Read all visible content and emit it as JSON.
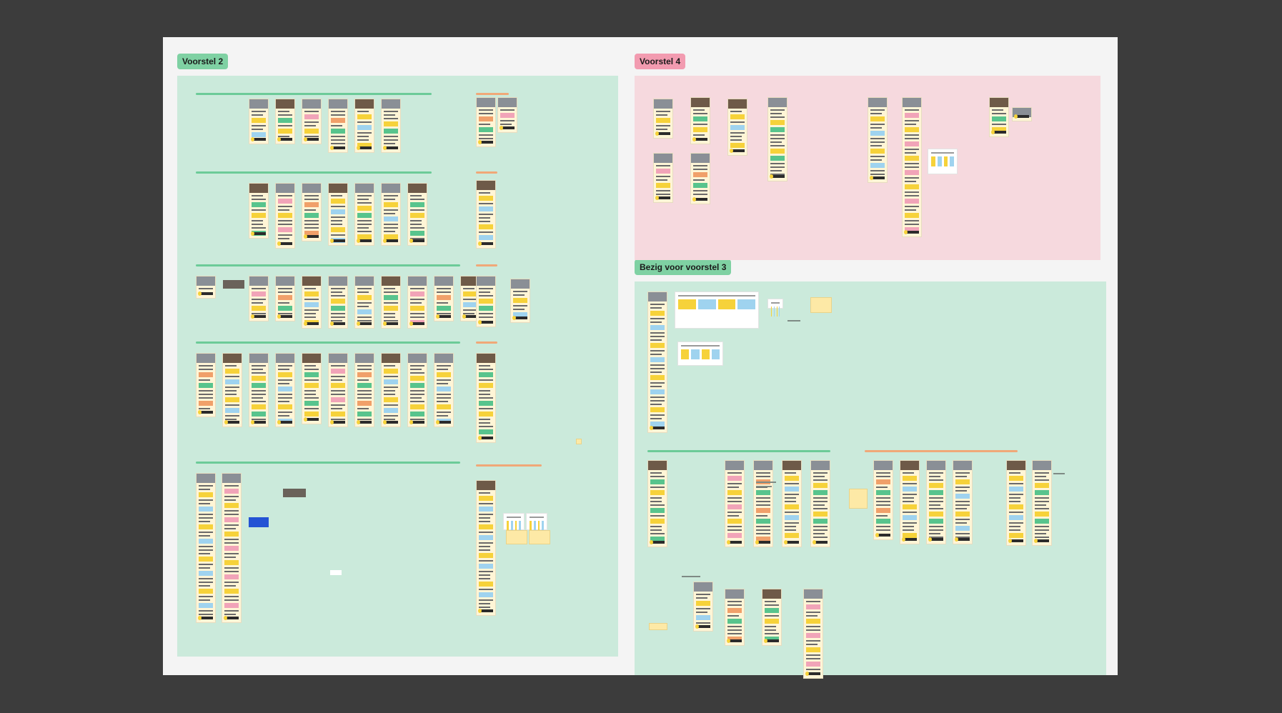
{
  "canvas": {
    "background": "#f4f4f4",
    "sections": [
      {
        "id": "voorstel-2",
        "label": "Voorstel 2",
        "color": "#cbeadb",
        "tag_color": "#7fd1a3"
      },
      {
        "id": "voorstel-4",
        "label": "Voorstel 4",
        "color": "#f6d9de",
        "tag_color": "#f29bb0"
      },
      {
        "id": "bezig-voorstel-3",
        "label": "Bezig voor voorstel 3",
        "color": "#cbeadb",
        "tag_color": "#7fd1a3"
      }
    ]
  },
  "colors": {
    "app_background": "#3c3c3c",
    "accent_yellow": "#f6d23a",
    "accent_green": "#58c48d",
    "accent_pink": "#f1a4b8",
    "accent_orange": "#f0a06a",
    "accent_blue": "#2453d4"
  }
}
